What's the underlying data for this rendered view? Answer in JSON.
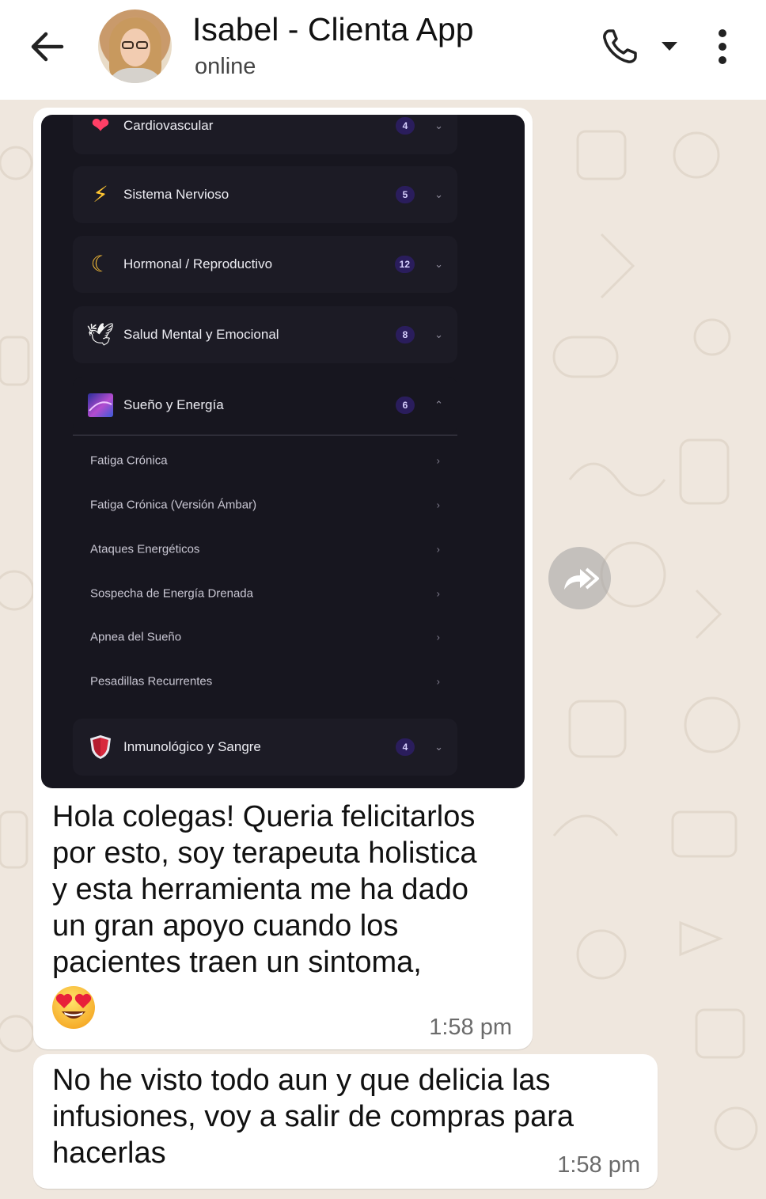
{
  "header": {
    "contact_name": "Isabel - Clienta App",
    "status": "online",
    "icons": {
      "back": "back-arrow-icon",
      "call": "phone-icon",
      "call_options": "dropdown-caret-icon",
      "menu": "more-vert-icon"
    }
  },
  "message_1": {
    "screenshot": {
      "categories": [
        {
          "label": "Cardiovascular",
          "count": "4",
          "icon": "heart-icon",
          "expanded": false
        },
        {
          "label": "Sistema Nervioso",
          "count": "5",
          "icon": "lightning-icon",
          "expanded": false
        },
        {
          "label": "Hormonal / Reproductivo",
          "count": "12",
          "icon": "moon-icon",
          "expanded": false
        },
        {
          "label": "Salud Mental y Emocional",
          "count": "8",
          "icon": "dove-icon",
          "expanded": false
        },
        {
          "label": "Sueño y Energía",
          "count": "6",
          "icon": "galaxy-icon",
          "expanded": true
        },
        {
          "label": "Inmunológico y Sangre",
          "count": "4",
          "icon": "shield-icon",
          "expanded": false
        }
      ],
      "subitems": [
        "Fatiga Crónica",
        "Fatiga Crónica (Versión Ámbar)",
        "Ataques Energéticos",
        "Sospecha de Energía Drenada",
        "Apnea del Sueño",
        "Pesadillas Recurrentes"
      ]
    },
    "text_lines": [
      "Hola colegas! Queria felicitarlos",
      "por esto, soy terapeuta holistica",
      "y esta herramienta me ha dado",
      "un gran apoyo cuando los",
      "pacientes traen un sintoma,"
    ],
    "emoji": "heart-eyes-emoji",
    "time": "1:58 pm"
  },
  "message_2": {
    "text_lines": [
      "No he visto todo aun y que delicia las",
      "infusiones, voy a salir de compras para",
      "hacerlas"
    ],
    "time": "1:58 pm"
  },
  "forward_icon": "forward-icon",
  "colors": {
    "header_bg": "#ffffff",
    "chat_bg": "#efe7de",
    "bubble": "#ffffff",
    "app_bg": "#17161f",
    "badge": "#2a1d5c"
  }
}
